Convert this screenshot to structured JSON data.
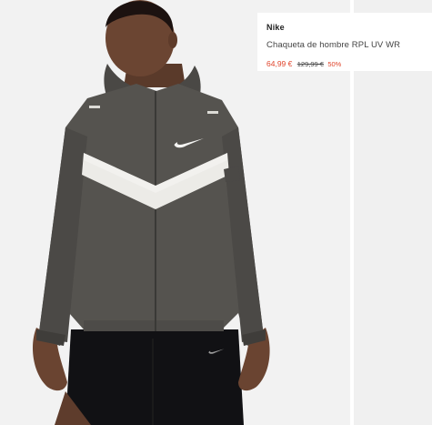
{
  "product": {
    "brand": "Nike",
    "name": "Chaqueta de hombre RPL UV WR",
    "price_current": "64,99 €",
    "price_original": "129,99 €",
    "discount": "50%"
  },
  "colors": {
    "accent_price": "#e0452c",
    "background": "#f2f2f2",
    "jacket": "#55534f",
    "reflective_stripe": "#ecebe7"
  },
  "icons": {
    "jacket_logo": "swoosh-icon",
    "shorts_logo": "swoosh-icon"
  }
}
